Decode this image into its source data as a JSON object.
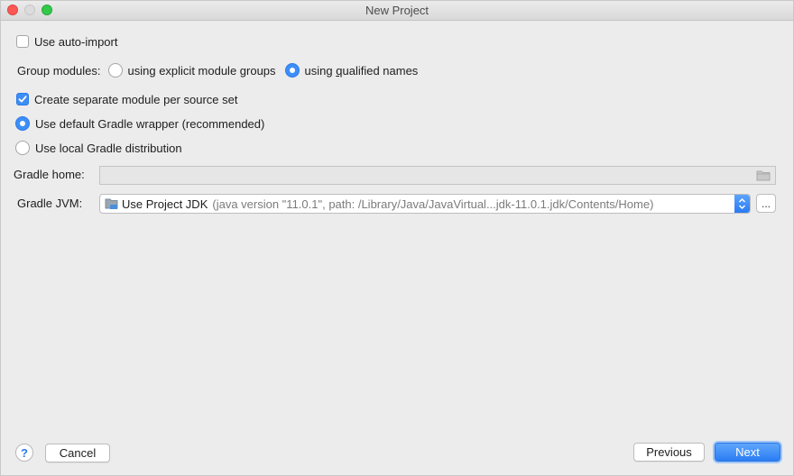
{
  "window": {
    "title": "New Project"
  },
  "options": {
    "auto_import_label": "Use auto-import",
    "auto_import_checked": false,
    "group_modules_label": "Group modules:",
    "group_explicit_label": "using explicit module groups",
    "group_qualified_label_pre": "using ",
    "group_qualified_label_underlined": "q",
    "group_qualified_label_post": "ualified names",
    "group_selected": "using qualified names",
    "separate_module_label": "Create separate module per source set",
    "separate_module_checked": true,
    "default_wrapper_label": "Use default Gradle wrapper (recommended)",
    "local_distribution_label": "Use local Gradle distribution",
    "gradle_selection": "Use default Gradle wrapper (recommended)"
  },
  "gradle_home": {
    "label": "Gradle home:",
    "value": ""
  },
  "gradle_jvm": {
    "label": "Gradle JVM:",
    "selected": "Use Project JDK",
    "detail": "(java version \"11.0.1\", path: /Library/Java/JavaVirtual...jdk-11.0.1.jdk/Contents/Home)",
    "browse_label": "..."
  },
  "footer": {
    "help_label": "?",
    "cancel_label": "Cancel",
    "previous_label": "Previous",
    "next_label": "Next"
  },
  "colors": {
    "accent": "#3d8ef7",
    "window_bg": "#ececec",
    "close": "#fc5753",
    "maximize": "#34c84a"
  },
  "icons": {
    "folder": "folder-icon",
    "jdk": "jdk-folder-icon",
    "stepper": "up-down-chevron-icon",
    "help": "help-icon"
  }
}
